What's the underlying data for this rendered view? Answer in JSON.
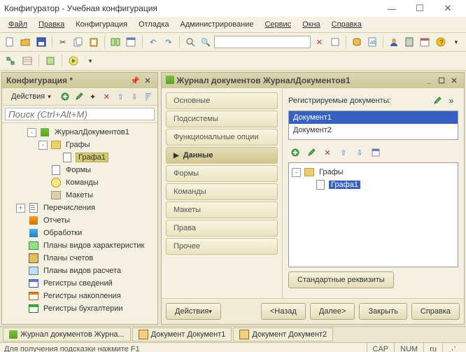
{
  "window": {
    "title": "Конфигуратор - Учебная конфигурация"
  },
  "menu": [
    "Файл",
    "Правка",
    "Конфигурация",
    "Отладка",
    "Администрирование",
    "Сервис",
    "Окна",
    "Справка"
  ],
  "toolbar_combo": "",
  "left": {
    "title": "Конфигурация *",
    "actions_label": "Действия",
    "search_placeholder": "Поиск (Ctrl+Alt+M)",
    "tree": [
      {
        "indent": 1,
        "exp": "-",
        "icon": "doc",
        "label": "ЖурналДокументов1"
      },
      {
        "indent": 2,
        "exp": "-",
        "icon": "fld",
        "label": "Графы"
      },
      {
        "indent": 3,
        "exp": "",
        "icon": "form",
        "label": "Графа1",
        "sel": true
      },
      {
        "indent": 2,
        "exp": "",
        "icon": "form",
        "label": "Формы"
      },
      {
        "indent": 2,
        "exp": "",
        "icon": "cmd",
        "label": "Команды"
      },
      {
        "indent": 2,
        "exp": "",
        "icon": "tmpl",
        "label": "Макеты"
      },
      {
        "indent": 0,
        "exp": "+",
        "icon": "enum",
        "label": "Перечисления"
      },
      {
        "indent": 0,
        "exp": "",
        "icon": "rep",
        "label": "Отчеты"
      },
      {
        "indent": 0,
        "exp": "",
        "icon": "proc",
        "label": "Обработки"
      },
      {
        "indent": 0,
        "exp": "",
        "icon": "char",
        "label": "Планы видов характеристик"
      },
      {
        "indent": 0,
        "exp": "",
        "icon": "acct",
        "label": "Планы счетов"
      },
      {
        "indent": 0,
        "exp": "",
        "icon": "calc",
        "label": "Планы видов расчета"
      },
      {
        "indent": 0,
        "exp": "",
        "icon": "reg",
        "label": "Регистры сведений"
      },
      {
        "indent": 0,
        "exp": "",
        "icon": "rega",
        "label": "Регистры накопления"
      },
      {
        "indent": 0,
        "exp": "",
        "icon": "regb",
        "label": "Регистры бухгалтерии"
      }
    ]
  },
  "right": {
    "title": "Журнал документов ЖурналДокументов1",
    "tabs": [
      "Основные",
      "Подсистемы",
      "Функциональные опции",
      "Данные",
      "Формы",
      "Команды",
      "Макеты",
      "Права",
      "Прочее"
    ],
    "active_tab": 3,
    "reg_label": "Регистрируемые документы:",
    "docs": [
      "Документ1",
      "Документ2"
    ],
    "sel_doc": 0,
    "cols_tree": [
      {
        "indent": 0,
        "exp": "-",
        "icon": "fld",
        "label": "Графы"
      },
      {
        "indent": 1,
        "exp": "",
        "icon": "form",
        "label": "Графа1",
        "sel": true
      }
    ],
    "std_req": "Стандартные реквизиты",
    "buttons": {
      "actions": "Действия",
      "back": "<Назад",
      "next": "Далее>",
      "close": "Закрыть",
      "help": "Справка"
    }
  },
  "wintabs": [
    "Журнал документов Журна...",
    "Документ Документ1",
    "Документ Документ2"
  ],
  "status": {
    "hint": "Для получения подсказки нажмите F1",
    "cap": "CAP",
    "num": "NUM",
    "lang": "ru"
  }
}
